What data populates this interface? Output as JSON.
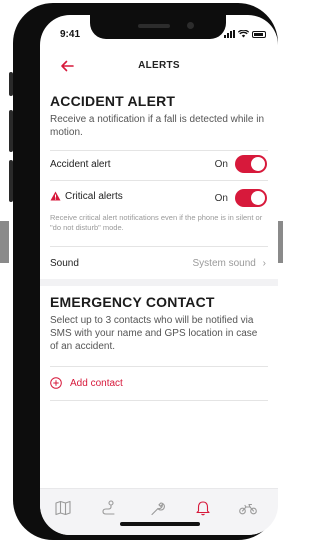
{
  "status_bar": {
    "time": "9:41"
  },
  "header": {
    "title": "ALERTS"
  },
  "accident_section": {
    "title": "ACCIDENT ALERT",
    "description": "Receive a notification if a fall is detected while in motion.",
    "accident_alert": {
      "label": "Accident alert",
      "state": "On"
    },
    "critical_alerts": {
      "label": "Critical alerts",
      "state": "On",
      "note": "Receive critical alert notifications even if the phone is in silent or \"do not disturb\" mode."
    },
    "sound": {
      "label": "Sound",
      "value": "System sound"
    }
  },
  "emergency_section": {
    "title": "EMERGENCY CONTACT",
    "description": "Select up to 3 contacts who will be notified via SMS with your name and GPS location in case of an accident.",
    "add_contact_label": "Add contact"
  },
  "tab_bar": {
    "items": [
      {
        "icon": "map-icon",
        "active": false
      },
      {
        "icon": "route-icon",
        "active": false
      },
      {
        "icon": "wrench-icon",
        "active": false
      },
      {
        "icon": "bell-icon",
        "active": true
      },
      {
        "icon": "motorcycle-icon",
        "active": false
      }
    ]
  },
  "colors": {
    "accent": "#d7193b",
    "muted": "#9a9a9a",
    "text": "#222222"
  }
}
